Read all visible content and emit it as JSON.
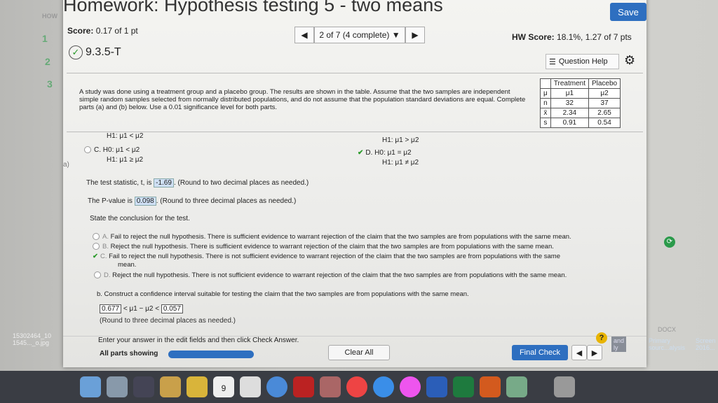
{
  "window": {
    "title": "Homework: Hypothesis testing 5 - two means",
    "save_label": "Save"
  },
  "background": {
    "labels": [
      "HOW",
      "1",
      "2",
      "3"
    ]
  },
  "score": {
    "label": "Score:",
    "value": "0.17 of 1 pt"
  },
  "nav": {
    "position": "2 of 7 (4 complete)",
    "prev": "◀",
    "next": "▶"
  },
  "hw_score": {
    "label": "HW Score:",
    "value": "18.1%, 1.27 of 7 pts"
  },
  "question": {
    "id": "9.3.5-T",
    "help_label": "Question Help",
    "text": "A study was done using a treatment group and a placebo group. The results are shown in the table. Assume that the two samples are independent simple random samples selected from normally distributed populations, and do not assume that the population standard deviations are equal. Complete parts (a) and (b) below. Use a 0.01 significance level for both parts."
  },
  "table": {
    "headers": [
      "",
      "Treatment",
      "Placebo"
    ],
    "rows": [
      [
        "μ",
        "μ1",
        "μ2"
      ],
      [
        "n",
        "32",
        "37"
      ],
      [
        "x̄",
        "2.34",
        "2.65"
      ],
      [
        "s",
        "0.91",
        "0.54"
      ]
    ]
  },
  "hypotheses": {
    "prev_c_h1": "H1: μ1 < μ2",
    "prev_d_h1": "H1: μ1 > μ2",
    "c_label": "C.",
    "c_h0": "H0: μ1 < μ2",
    "c_h1": "H1: μ1 ≥ μ2",
    "d_label": "D.",
    "d_h0": "H0: μ1 = μ2",
    "d_h1": "H1: μ1 ≠ μ2",
    "part": "a)"
  },
  "test_stat": {
    "prefix": "The test statistic, t, is",
    "value": "-1.69",
    "suffix": ". (Round to two decimal places as needed.)"
  },
  "p_value": {
    "prefix": "The P-value is",
    "value": "0.098",
    "suffix": ". (Round to three decimal places as needed.)"
  },
  "conclusion": {
    "prompt": "State the conclusion for the test.",
    "options": [
      {
        "label": "A.",
        "text": "Fail to reject the null hypothesis. There is sufficient evidence to warrant rejection of the claim that the two samples are from populations with the same mean."
      },
      {
        "label": "B.",
        "text": "Reject the null hypothesis. There is sufficient evidence to warrant rejection of the claim that the two samples are from populations with the same mean."
      },
      {
        "label": "C.",
        "text": "Fail to reject the null hypothesis. There is not sufficient evidence to warrant rejection of the claim that the two samples are from populations with the same",
        "text2": "mean."
      },
      {
        "label": "D.",
        "text": "Reject the null hypothesis. There is not sufficient evidence to warrant rejection of the claim that the two samples are from populations with the same mean."
      }
    ],
    "selected": "C."
  },
  "part_b": {
    "prompt": "b. Construct a confidence interval suitable for testing the claim that the two samples are from populations with the same mean.",
    "lower": "0.677",
    "middle": "< μ1 − μ2 <",
    "upper": "0.057",
    "note": "(Round to three decimal places as needed.)"
  },
  "footer": {
    "instruction": "Enter your answer in the edit fields and then click Check Answer.",
    "parts": "All parts showing",
    "clear": "Clear All",
    "final": "Final Check",
    "help": "?"
  },
  "desktop": {
    "left_file": "15302464_10\n1545..._o.jpg",
    "right1": "Primary\nsourc...alysis",
    "right2": "Screen\n2016...",
    "right3": "DOCX",
    "right4": "and\nly"
  },
  "dock": {
    "calendar_day": "9"
  },
  "colors": {
    "accent": "#2e6fc0",
    "check": "#2a9a2a",
    "answer_bg": "#cfe0f5"
  }
}
